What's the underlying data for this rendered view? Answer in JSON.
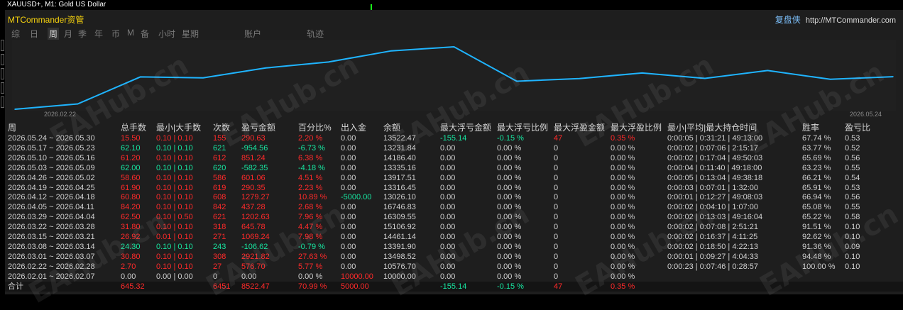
{
  "window": {
    "title": "XAUUSD+, M1:  Gold US Dollar"
  },
  "header": {
    "app_name": "MTCommander资管",
    "brand_cn": "复盘侠",
    "brand_url": "http://MTCommander.com"
  },
  "tabs": [
    {
      "label": "综",
      "active": false
    },
    {
      "label": "日",
      "active": false
    },
    {
      "label": "周",
      "active": true
    },
    {
      "label": "月",
      "active": false
    },
    {
      "label": "季",
      "active": false
    },
    {
      "label": "年",
      "active": false
    },
    {
      "label": "币",
      "active": false
    },
    {
      "label": "M",
      "active": false
    },
    {
      "label": "备",
      "active": false
    },
    {
      "label": "小时",
      "active": false
    },
    {
      "label": "星期",
      "active": false
    },
    {
      "label": "账户",
      "active": false
    },
    {
      "label": "轨迹",
      "active": false
    }
  ],
  "chart_data": {
    "type": "line",
    "x_start_label": "2026.02.22",
    "x_end_label": "2026.05.24",
    "series": [
      {
        "x": [
          "2026.02.01",
          "2026.02.22",
          "2026.03.01",
          "2026.03.08",
          "2026.03.15",
          "2026.03.22",
          "2026.03.29",
          "2026.04.05",
          "2026.04.12",
          "2026.04.19",
          "2026.04.26",
          "2026.05.03",
          "2026.05.10",
          "2026.05.17",
          "2026.05.24"
        ],
        "values": [
          10000.0,
          10576.7,
          13498.52,
          13391.9,
          14461.14,
          15106.92,
          16309.55,
          16746.83,
          13026.1,
          13316.45,
          13917.51,
          13335.16,
          14186.4,
          13231.84,
          13522.47
        ]
      }
    ],
    "line_color": "#1fb4ff"
  },
  "table": {
    "headers": [
      "周",
      "总手数",
      "最小|大手数",
      "次数",
      "盈亏金额",
      "百分比%",
      "出入金",
      "余额",
      "最大浮亏金额",
      "最大浮亏比例",
      "最大浮盈金额",
      "最大浮盈比例",
      "最小|平均|最大持仓时间",
      "胜率",
      "盈亏比"
    ],
    "rows": [
      {
        "week": "2026.05.24 ~ 2026.05.30",
        "lots": "15.50",
        "minmax": "0.10 | 0.10",
        "count": "155",
        "pnl": "290.63",
        "pct": "2.20 %",
        "flow": "0.00",
        "balance": "13522.47",
        "maxdd": "-155.14",
        "maxddpct": "-0.15 %",
        "maxfp": "47",
        "maxfppct": "0.35 %",
        "hold": "0:00:05 | 0:31:21 | 49:13:00",
        "win": "67.74 %",
        "pf": "0.53",
        "sign": "pos",
        "ddsign": "neg",
        "fpsign": "pos"
      },
      {
        "week": "2026.05.17 ~ 2026.05.23",
        "lots": "62.10",
        "minmax": "0.10 | 0.10",
        "count": "621",
        "pnl": "-954.56",
        "pct": "-6.73 %",
        "flow": "0.00",
        "balance": "13231.84",
        "maxdd": "0.00",
        "maxddpct": "0.00 %",
        "maxfp": "0",
        "maxfppct": "0.00 %",
        "hold": "0:00:02 | 0:07:06 | 2:15:17",
        "win": "63.77 %",
        "pf": "0.52",
        "sign": "neg",
        "ddsign": "",
        "fpsign": ""
      },
      {
        "week": "2026.05.10 ~ 2026.05.16",
        "lots": "61.20",
        "minmax": "0.10 | 0.10",
        "count": "612",
        "pnl": "851.24",
        "pct": "6.38 %",
        "flow": "0.00",
        "balance": "14186.40",
        "maxdd": "0.00",
        "maxddpct": "0.00 %",
        "maxfp": "0",
        "maxfppct": "0.00 %",
        "hold": "0:00:02 | 0:17:04 | 49:50:03",
        "win": "65.69 %",
        "pf": "0.56",
        "sign": "pos",
        "ddsign": "",
        "fpsign": ""
      },
      {
        "week": "2026.05.03 ~ 2026.05.09",
        "lots": "62.00",
        "minmax": "0.10 | 0.10",
        "count": "620",
        "pnl": "-582.35",
        "pct": "-4.18 %",
        "flow": "0.00",
        "balance": "13335.16",
        "maxdd": "0.00",
        "maxddpct": "0.00 %",
        "maxfp": "0",
        "maxfppct": "0.00 %",
        "hold": "0:00:04 | 0:11:40 | 49:18:00",
        "win": "63.23 %",
        "pf": "0.55",
        "sign": "neg",
        "ddsign": "",
        "fpsign": ""
      },
      {
        "week": "2026.04.26 ~ 2026.05.02",
        "lots": "58.60",
        "minmax": "0.10 | 0.10",
        "count": "586",
        "pnl": "601.06",
        "pct": "4.51 %",
        "flow": "0.00",
        "balance": "13917.51",
        "maxdd": "0.00",
        "maxddpct": "0.00 %",
        "maxfp": "0",
        "maxfppct": "0.00 %",
        "hold": "0:00:05 | 0:13:04 | 49:38:18",
        "win": "66.21 %",
        "pf": "0.54",
        "sign": "pos",
        "ddsign": "",
        "fpsign": ""
      },
      {
        "week": "2026.04.19 ~ 2026.04.25",
        "lots": "61.90",
        "minmax": "0.10 | 0.10",
        "count": "619",
        "pnl": "290.35",
        "pct": "2.23 %",
        "flow": "0.00",
        "balance": "13316.45",
        "maxdd": "0.00",
        "maxddpct": "0.00 %",
        "maxfp": "0",
        "maxfppct": "0.00 %",
        "hold": "0:00:03 | 0:07:01 | 1:32:00",
        "win": "65.91 %",
        "pf": "0.53",
        "sign": "pos",
        "ddsign": "",
        "fpsign": ""
      },
      {
        "week": "2026.04.12 ~ 2026.04.18",
        "lots": "60.80",
        "minmax": "0.10 | 0.10",
        "count": "608",
        "pnl": "1279.27",
        "pct": "10.89 %",
        "flow": "-5000.00",
        "balance": "13026.10",
        "maxdd": "0.00",
        "maxddpct": "0.00 %",
        "maxfp": "0",
        "maxfppct": "0.00 %",
        "hold": "0:00:01 | 0:12:27 | 49:08:03",
        "win": "66.94 %",
        "pf": "0.56",
        "sign": "pos",
        "ddsign": "",
        "fpsign": "",
        "flowsign": "neg"
      },
      {
        "week": "2026.04.05 ~ 2026.04.11",
        "lots": "84.20",
        "minmax": "0.10 | 0.10",
        "count": "842",
        "pnl": "437.28",
        "pct": "2.68 %",
        "flow": "0.00",
        "balance": "16746.83",
        "maxdd": "0.00",
        "maxddpct": "0.00 %",
        "maxfp": "0",
        "maxfppct": "0.00 %",
        "hold": "0:00:02 | 0:04:10 | 1:07:00",
        "win": "65.08 %",
        "pf": "0.55",
        "sign": "pos",
        "ddsign": "",
        "fpsign": ""
      },
      {
        "week": "2026.03.29 ~ 2026.04.04",
        "lots": "62.50",
        "minmax": "0.10 | 0.50",
        "count": "621",
        "pnl": "1202.63",
        "pct": "7.96 %",
        "flow": "0.00",
        "balance": "16309.55",
        "maxdd": "0.00",
        "maxddpct": "0.00 %",
        "maxfp": "0",
        "maxfppct": "0.00 %",
        "hold": "0:00:02 | 0:13:03 | 49:16:04",
        "win": "65.22 %",
        "pf": "0.58",
        "sign": "pos",
        "ddsign": "",
        "fpsign": ""
      },
      {
        "week": "2026.03.22 ~ 2026.03.28",
        "lots": "31.80",
        "minmax": "0.10 | 0.10",
        "count": "318",
        "pnl": "645.78",
        "pct": "4.47 %",
        "flow": "0.00",
        "balance": "15106.92",
        "maxdd": "0.00",
        "maxddpct": "0.00 %",
        "maxfp": "0",
        "maxfppct": "0.00 %",
        "hold": "0:00:02 | 0:07:08 | 2:51:21",
        "win": "91.51 %",
        "pf": "0.10",
        "sign": "pos",
        "ddsign": "",
        "fpsign": ""
      },
      {
        "week": "2026.03.15 ~ 2026.03.21",
        "lots": "26.92",
        "minmax": "0.01 | 0.10",
        "count": "271",
        "pnl": "1069.24",
        "pct": "7.98 %",
        "flow": "0.00",
        "balance": "14461.14",
        "maxdd": "0.00",
        "maxddpct": "0.00 %",
        "maxfp": "0",
        "maxfppct": "0.00 %",
        "hold": "0:00:02 | 0:16:37 | 4:11:25",
        "win": "92.62 %",
        "pf": "0.10",
        "sign": "pos",
        "ddsign": "",
        "fpsign": ""
      },
      {
        "week": "2026.03.08 ~ 2026.03.14",
        "lots": "24.30",
        "minmax": "0.10 | 0.10",
        "count": "243",
        "pnl": "-106.62",
        "pct": "-0.79 %",
        "flow": "0.00",
        "balance": "13391.90",
        "maxdd": "0.00",
        "maxddpct": "0.00 %",
        "maxfp": "0",
        "maxfppct": "0.00 %",
        "hold": "0:00:02 | 0:18:50 | 4:22:13",
        "win": "91.36 %",
        "pf": "0.09",
        "sign": "neg",
        "ddsign": "",
        "fpsign": ""
      },
      {
        "week": "2026.03.01 ~ 2026.03.07",
        "lots": "30.80",
        "minmax": "0.10 | 0.10",
        "count": "308",
        "pnl": "2921.82",
        "pct": "27.63 %",
        "flow": "0.00",
        "balance": "13498.52",
        "maxdd": "0.00",
        "maxddpct": "0.00 %",
        "maxfp": "0",
        "maxfppct": "0.00 %",
        "hold": "0:00:01 | 0:09:27 | 4:04:33",
        "win": "94.48 %",
        "pf": "0.10",
        "sign": "pos",
        "ddsign": "",
        "fpsign": ""
      },
      {
        "week": "2026.02.22 ~ 2026.02.28",
        "lots": "2.70",
        "minmax": "0.10 | 0.10",
        "count": "27",
        "pnl": "576.70",
        "pct": "5.77 %",
        "flow": "0.00",
        "balance": "10576.70",
        "maxdd": "0.00",
        "maxddpct": "0.00 %",
        "maxfp": "0",
        "maxfppct": "0.00 %",
        "hold": "0:00:23 | 0:07:46 | 0:28:57",
        "win": "100.00 %",
        "pf": "0.10",
        "sign": "pos",
        "ddsign": "",
        "fpsign": ""
      },
      {
        "week": "2026.02.01 ~ 2026.02.07",
        "lots": "0.00",
        "minmax": "0.00 | 0.00",
        "count": "0",
        "pnl": "0.00",
        "pct": "0.00 %",
        "flow": "10000.00",
        "balance": "10000.00",
        "maxdd": "0.00",
        "maxddpct": "0.00 %",
        "maxfp": "0",
        "maxfppct": "0.00 %",
        "hold": "",
        "win": "",
        "pf": "",
        "sign": "zero",
        "ddsign": "",
        "fpsign": "",
        "flowsign": "pos"
      }
    ],
    "total": {
      "label": "合计",
      "lots": "645.32",
      "count": "6451",
      "pnl": "8522.47",
      "pct": "70.99 %",
      "flow": "5000.00",
      "maxdd": "-155.14",
      "maxddpct": "-0.15 %",
      "maxfp": "47",
      "maxfppct": "0.35 %"
    }
  },
  "watermark": "EAHub.cn",
  "colors": {
    "positive": "#ff2a2a",
    "negative": "#17e5a0",
    "accent": "#f5d10e",
    "line": "#1fb4ff"
  }
}
